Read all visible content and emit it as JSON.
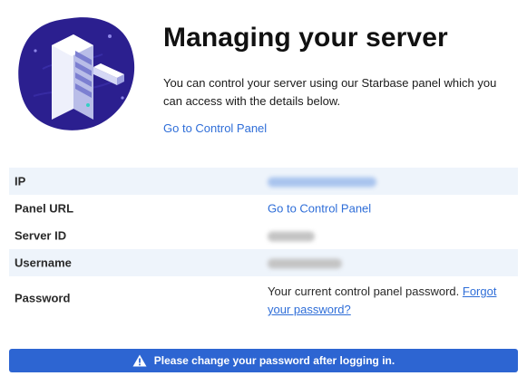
{
  "hero": {
    "title": "Managing your server",
    "description": "You can control your server using our Starbase panel which you can access with the details below.",
    "link_label": "Go to Control Panel",
    "illustration_icon": "server-rack-illustration"
  },
  "details": {
    "rows": [
      {
        "label": "IP",
        "value_redacted": true
      },
      {
        "label": "Panel URL",
        "value": "Go to Control Panel"
      },
      {
        "label": "Server ID",
        "value_redacted": true
      },
      {
        "label": "Username",
        "value_redacted": true
      },
      {
        "label": "Password",
        "value": "Your current control panel password.",
        "link_label": "Forgot your password?"
      }
    ]
  },
  "alert": {
    "icon": "warning-icon",
    "text": "Please change your password after logging in."
  },
  "colors": {
    "accent": "#2f6ed8",
    "banner": "#2d65d2",
    "row_shade": "#eef4fb",
    "illustration_blob": "#2b1f8f"
  }
}
